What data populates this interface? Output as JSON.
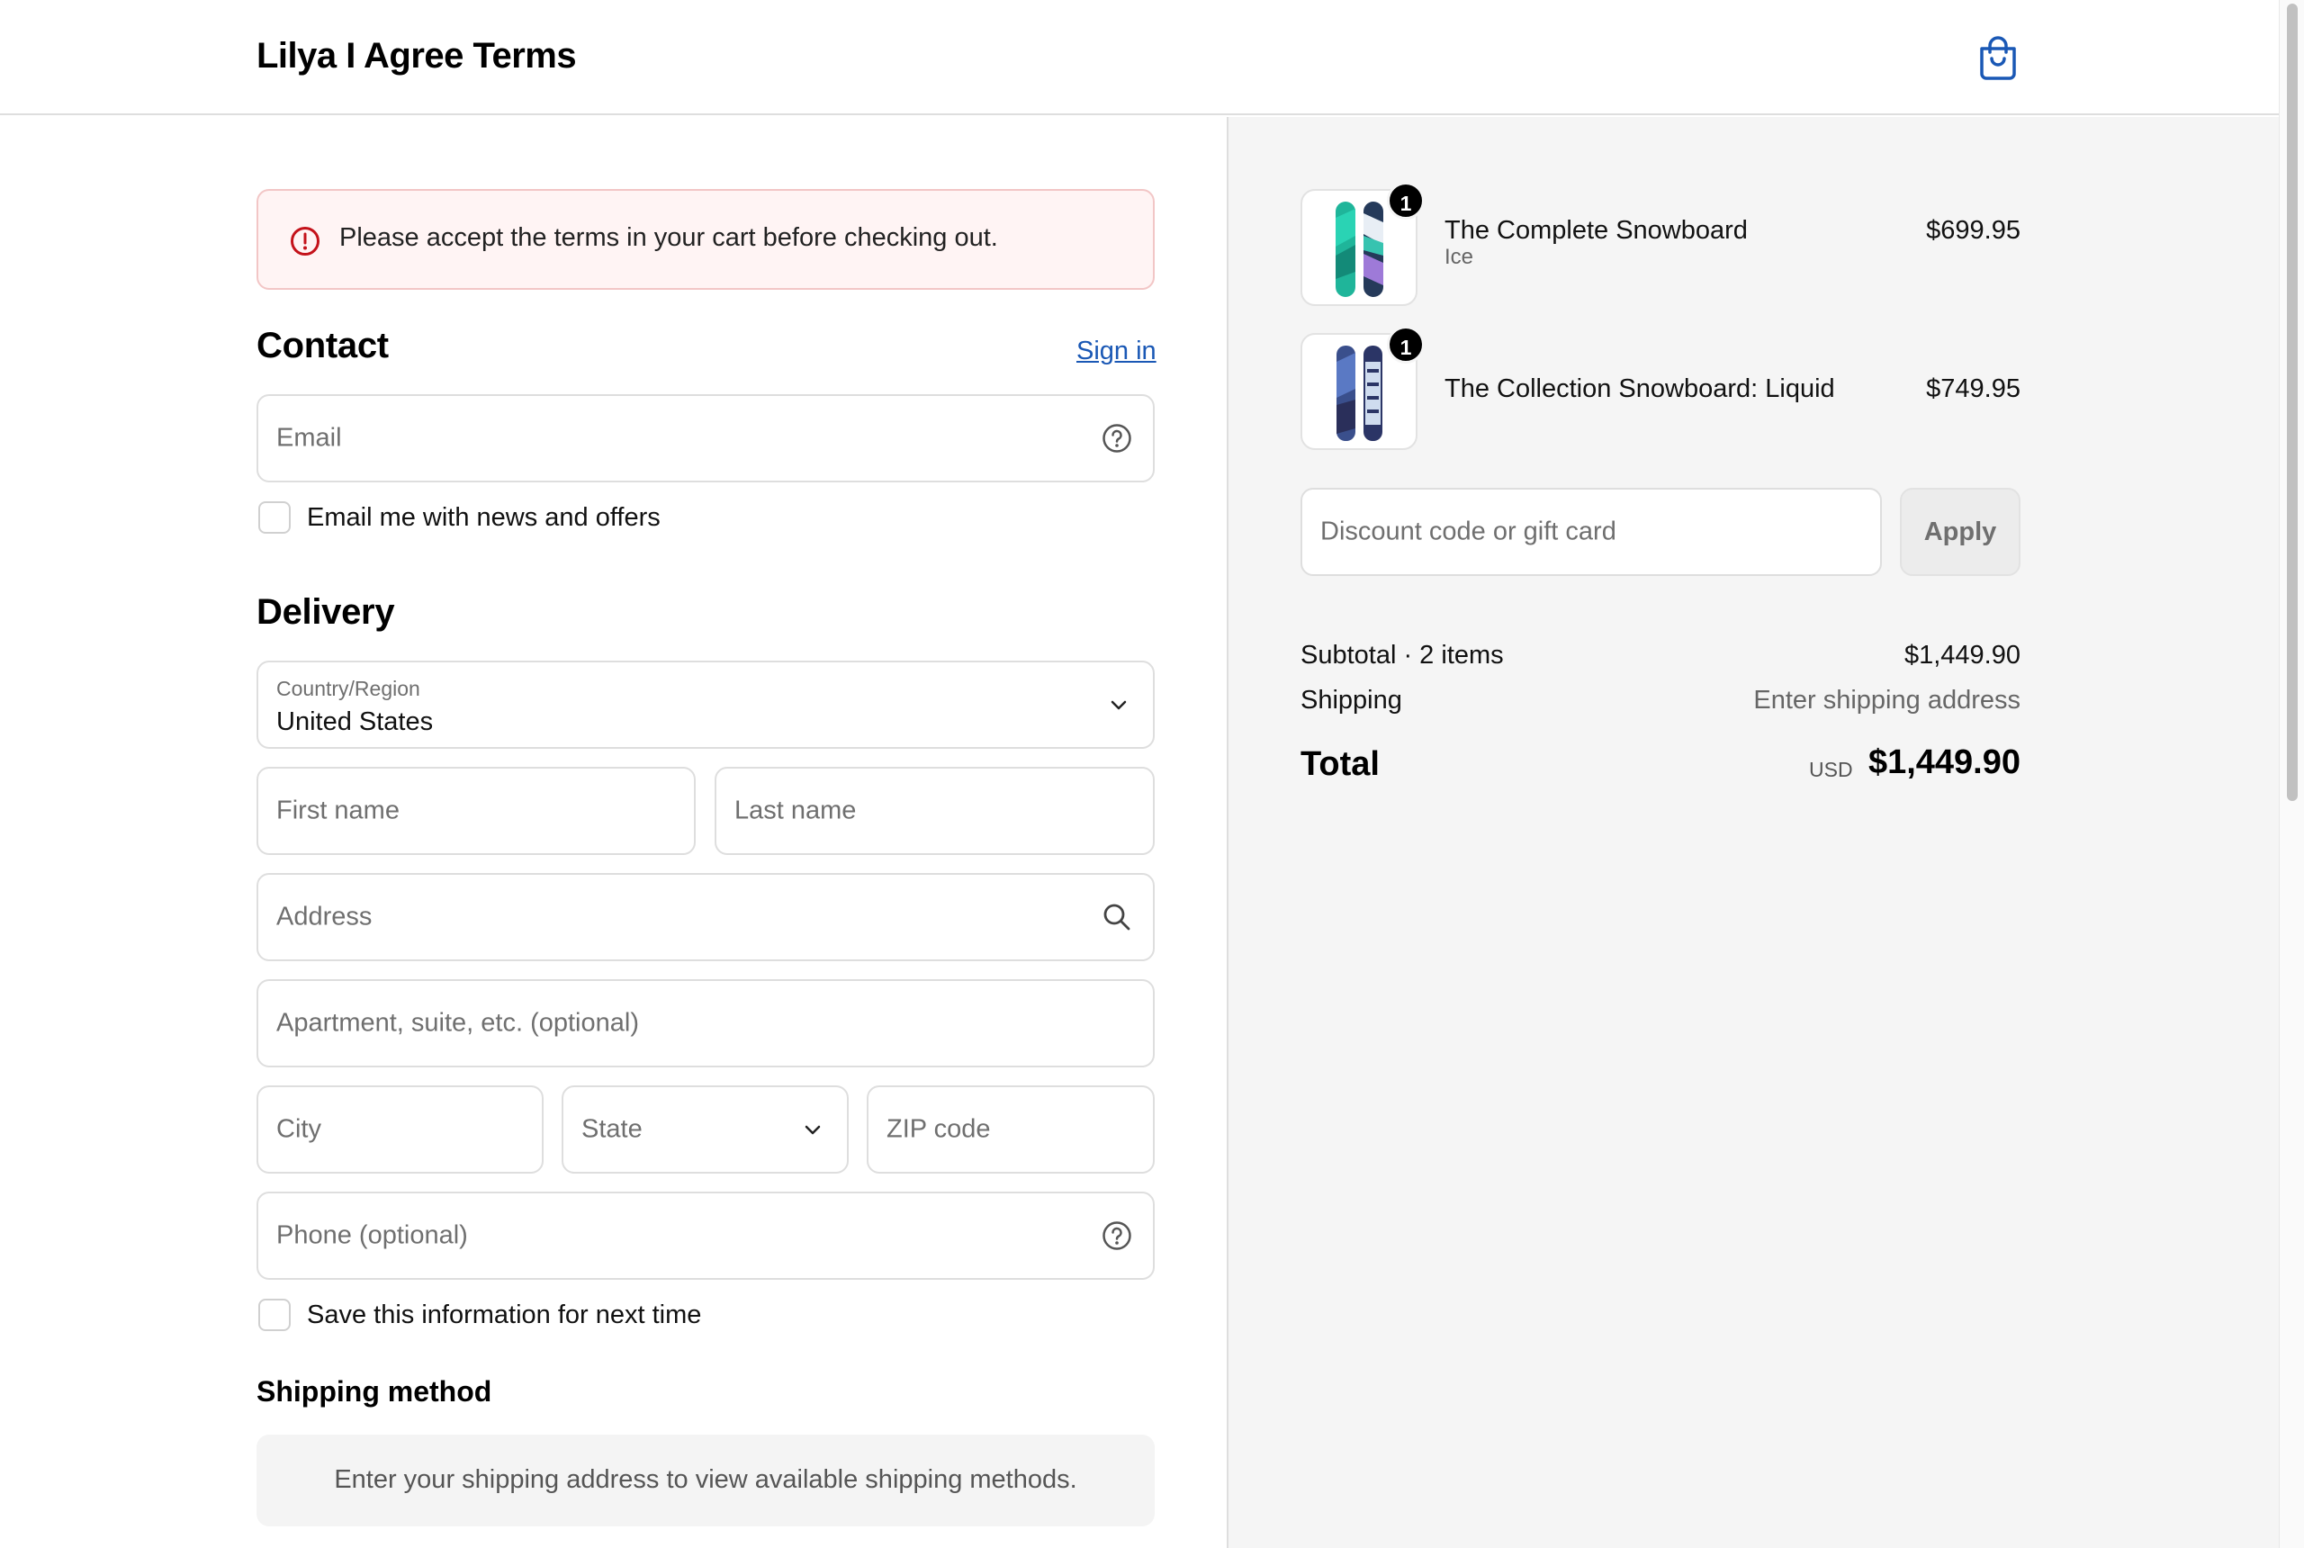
{
  "header": {
    "shop_title": "Lilya I Agree Terms",
    "cart_icon": "shopping-bag-icon"
  },
  "alert": {
    "icon": "error-circle-icon",
    "message": "Please accept the terms in your cart before checking out."
  },
  "contact": {
    "heading": "Contact",
    "sign_in": "Sign in",
    "email_placeholder": "Email",
    "newsletter_label": "Email me with news and offers"
  },
  "delivery": {
    "heading": "Delivery",
    "country_label": "Country/Region",
    "country_value": "United States",
    "first_name": "First name",
    "last_name": "Last name",
    "address": "Address",
    "apartment": "Apartment, suite, etc. (optional)",
    "city": "City",
    "state": "State",
    "zip": "ZIP code",
    "phone": "Phone (optional)",
    "save_label": "Save this information for next time"
  },
  "shipping_method": {
    "heading": "Shipping method",
    "message": "Enter your shipping address to view available shipping methods."
  },
  "cart": {
    "items": [
      {
        "name": "The Complete Snowboard",
        "variant": "Ice",
        "price": "$699.95",
        "quantity": "1"
      },
      {
        "name": "The Collection Snowboard: Liquid",
        "variant": "",
        "price": "$749.95",
        "quantity": "1"
      }
    ],
    "discount_placeholder": "Discount code or gift card",
    "apply": "Apply",
    "subtotal_label": "Subtotal · 2 items",
    "subtotal_value": "$1,449.90",
    "shipping_label": "Shipping",
    "shipping_value": "Enter shipping address",
    "total_label": "Total",
    "currency": "USD",
    "total_value": "$1,449.90"
  },
  "colors": {
    "link": "#1a58b5",
    "error": "#c4121a",
    "summary_bg": "#f5f5f5"
  }
}
